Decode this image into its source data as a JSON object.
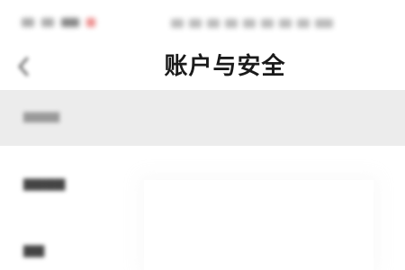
{
  "header": {
    "title": "账户与安全"
  },
  "icons": {
    "back": "chevron-left-icon"
  }
}
